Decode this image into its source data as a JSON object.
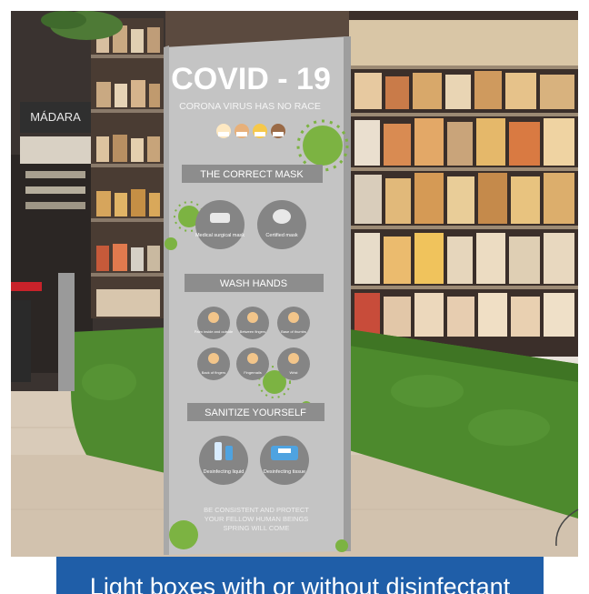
{
  "poster": {
    "title": "COVID - 19",
    "subtitle": "CORONA VIRUS HAS NO RACE",
    "section_mask": "THE CORRECT MASK",
    "mask_items": [
      "Medical surgical mask",
      "Certified mask"
    ],
    "section_wash": "WASH HANDS",
    "wash_items": [
      "Palm inside and outside",
      "Between fingers",
      "Base of thumbs",
      "Back of fingers",
      "Fingernails",
      "Wrist"
    ],
    "section_sanitize": "SANITIZE YOURSELF",
    "sanitize_items": [
      "Desinfecting liquid",
      "Desinfecting tissue"
    ],
    "footer_lines": [
      "BE CONSISTENT AND PROTECT",
      "YOUR FELLOW HUMAN BEINGS",
      "SPRING WILL COME"
    ]
  },
  "store_sign": {
    "brand": "MÁDARA"
  },
  "caption": {
    "text": "Light boxes with or without disinfectant"
  },
  "colors": {
    "virus_green": "#7cb342",
    "caption_blue": "#1f5ea8",
    "poster_gray": "#c4c4c4"
  }
}
